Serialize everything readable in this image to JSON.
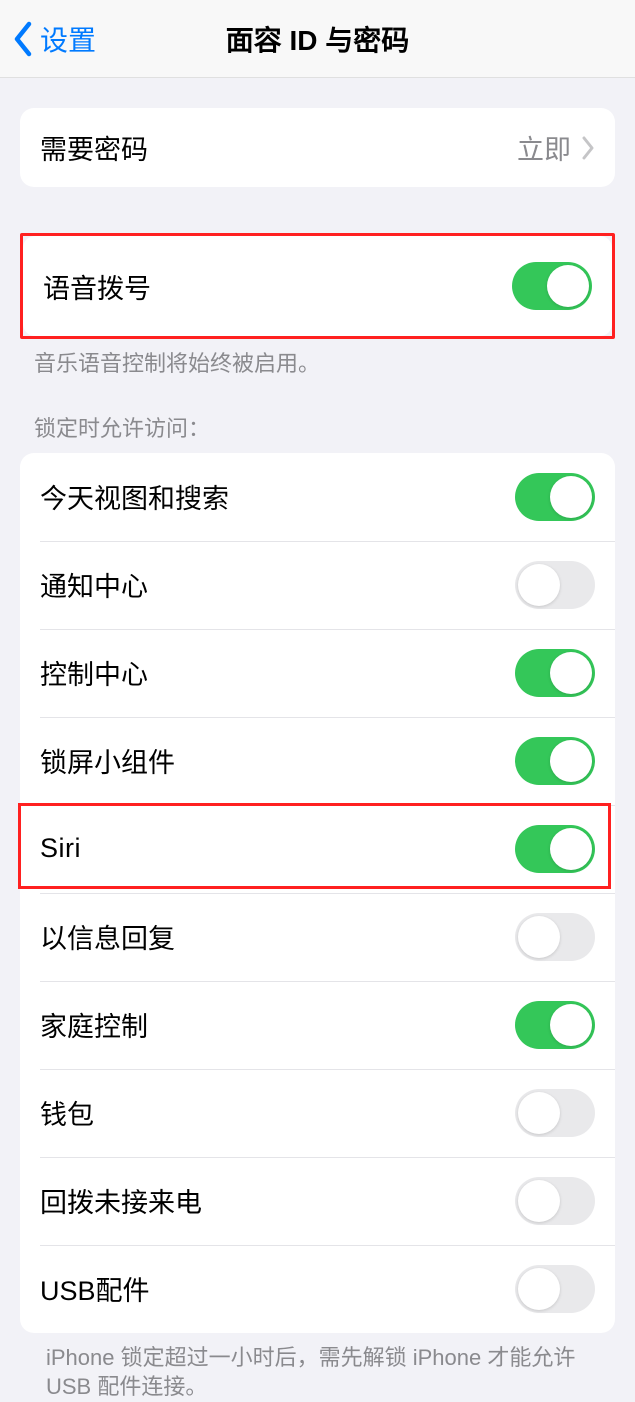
{
  "header": {
    "back_label": "设置",
    "title": "面容 ID 与密码"
  },
  "require_passcode": {
    "label": "需要密码",
    "value": "立即"
  },
  "voice_dial": {
    "label": "语音拨号",
    "footer": "音乐语音控制将始终被启用。",
    "on": true
  },
  "lock_access": {
    "header": "锁定时允许访问：",
    "items": [
      {
        "label": "今天视图和搜索",
        "on": true
      },
      {
        "label": "通知中心",
        "on": false
      },
      {
        "label": "控制中心",
        "on": true
      },
      {
        "label": "锁屏小组件",
        "on": true
      },
      {
        "label": "Siri",
        "on": true
      },
      {
        "label": "以信息回复",
        "on": false
      },
      {
        "label": "家庭控制",
        "on": true
      },
      {
        "label": "钱包",
        "on": false
      },
      {
        "label": "回拨未接来电",
        "on": false
      },
      {
        "label": "USB配件",
        "on": false
      }
    ],
    "footer": "iPhone 锁定超过一小时后，需先解锁 iPhone 才能允许USB 配件连接。"
  }
}
